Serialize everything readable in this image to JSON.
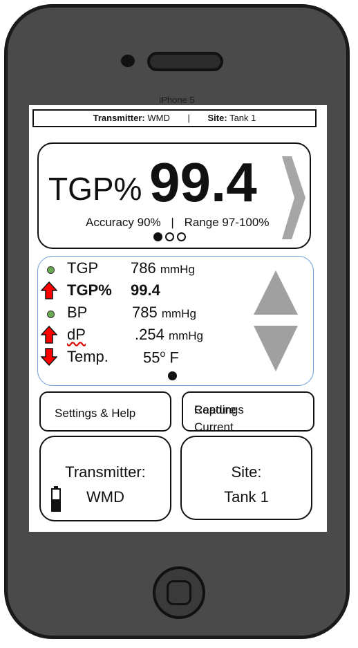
{
  "device": {
    "model_label": "iPhone 5"
  },
  "header": {
    "transmitter_key": "Transmitter:",
    "transmitter_value": "WMD",
    "separator": "|",
    "site_key": "Site:",
    "site_value": "Tank 1"
  },
  "main": {
    "label": "TGP%",
    "value": "99.4",
    "accuracy": "Accuracy 90%",
    "separator": "|",
    "range": "Range 97-100%",
    "page_dots": {
      "count": 3,
      "active_index": 0
    }
  },
  "readings": [
    {
      "name": "TGP",
      "value": "786",
      "unit": "mmHg",
      "indicator": "green-dot-icon",
      "bold": false
    },
    {
      "name": "TGP%",
      "value": "99.4",
      "unit": "",
      "indicator": "red-up-arrow-icon",
      "bold": true
    },
    {
      "name": "BP",
      "value": "785",
      "unit": "mmHg",
      "indicator": "green-dot-icon",
      "bold": false
    },
    {
      "name": "dP",
      "value": ".254",
      "unit": "mmHg",
      "indicator": "red-up-arrow-icon",
      "bold": false
    },
    {
      "name": "Temp.",
      "value": "55",
      "unit": "F",
      "degree": "o",
      "indicator": "red-down-arrow-icon",
      "bold": false
    }
  ],
  "buttons": {
    "settings": "Settings & Help",
    "capture_line1": "Capture Current",
    "capture_line2": "Readings"
  },
  "cards": {
    "transmitter_label": "Transmitter:",
    "transmitter_value": "WMD",
    "site_label": "Site:",
    "site_value": "Tank 1"
  },
  "colors": {
    "indicator_green": "#6aa84f",
    "arrow_red": "#ff0000",
    "scroll_arrow_gray": "#a0a0a0",
    "chevron_gray": "#a6a6a6",
    "readings_border": "#6b9fd6"
  }
}
